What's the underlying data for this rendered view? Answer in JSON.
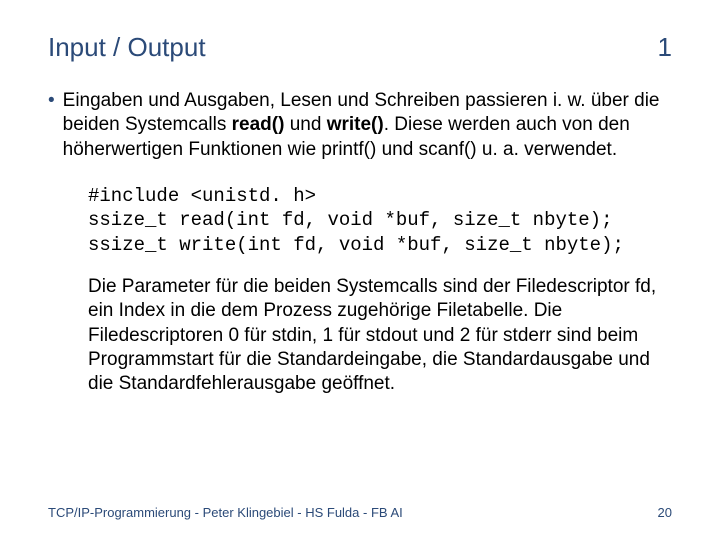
{
  "header": {
    "title": "Input / Output",
    "slide_number_top": "1"
  },
  "bullet": {
    "pre": "Eingaben und Ausgaben, Lesen und Schreiben passieren i. w. über die beiden Systemcalls ",
    "bold1": "read()",
    "mid": " und ",
    "bold2": "write()",
    "post": ". Diese werden auch von den höherwertigen Funktionen wie printf() und scanf() u. a. verwendet."
  },
  "code": "#include <unistd. h>\nssize_t read(int fd, void *buf, size_t nbyte);\nssize_t write(int fd, void *buf, size_t nbyte);",
  "sub_para": "Die Parameter für die beiden Systemcalls sind der File­descriptor fd, ein Index in die dem Prozess zugehörige Filetabelle. Die Filedescriptoren 0 für stdin, 1 für stdout und 2 für stderr sind beim Programmstart für die Stan­dardeingabe, die Standardausgabe und die Standard­fehlerausgabe geöffnet.",
  "footer": {
    "left": "TCP/IP-Programmierung - Peter Klingebiel - HS Fulda - FB AI",
    "page_number": "20"
  }
}
